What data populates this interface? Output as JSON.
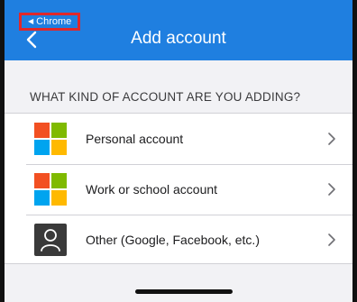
{
  "header": {
    "back_app_label": "Chrome",
    "title": "Add account"
  },
  "section": {
    "label": "WHAT KIND OF ACCOUNT ARE YOU ADDING?"
  },
  "accounts": [
    {
      "label": "Personal account",
      "icon": "microsoft-logo-icon"
    },
    {
      "label": "Work or school account",
      "icon": "microsoft-logo-icon"
    },
    {
      "label": "Other (Google, Facebook, etc.)",
      "icon": "person-icon"
    }
  ],
  "colors": {
    "header": "#1f7fe0",
    "highlight_box": "#e0282a"
  }
}
